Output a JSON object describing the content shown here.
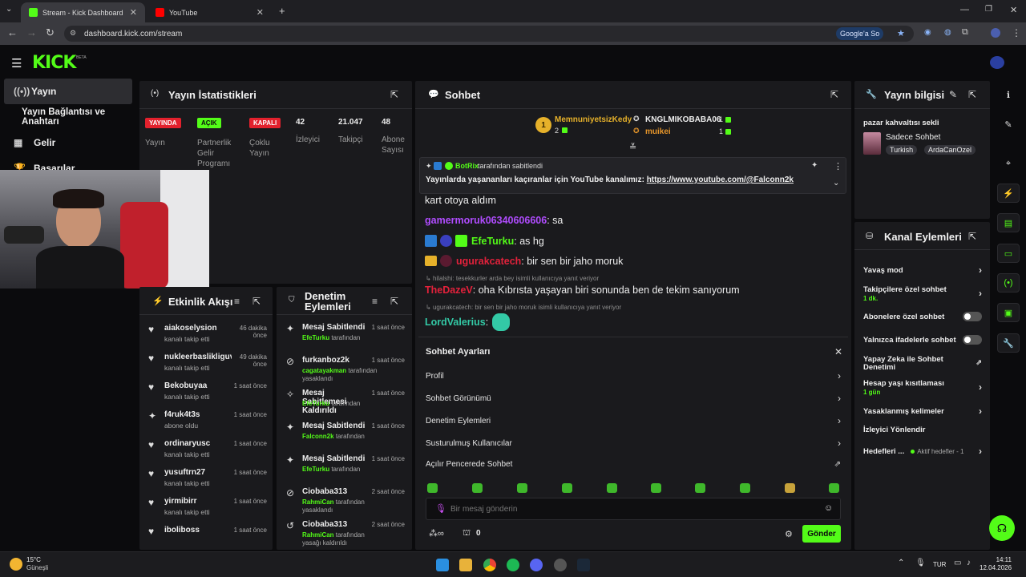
{
  "browser": {
    "tabs": [
      {
        "title": "Stream - Kick Dashboard"
      },
      {
        "title": "YouTube"
      }
    ],
    "url": "dashboard.kick.com/stream",
    "search_chip": "Google'a So"
  },
  "header": {
    "logo": "KICK",
    "beta": "BETA"
  },
  "sidebar": {
    "items": [
      {
        "label": "Yayın",
        "icon": "broadcast-icon"
      },
      {
        "label": "Yayın Bağlantısı ve Anahtarı",
        "icon": ""
      },
      {
        "label": "Gelir",
        "icon": "chart-icon"
      },
      {
        "label": "Başarılar",
        "icon": "trophy-icon"
      }
    ]
  },
  "stats": {
    "title": "Yayın İstatistikleri",
    "badges": [
      {
        "text": "YAYINDA",
        "label": "Yayın",
        "color": "#e3212d"
      },
      {
        "text": "AÇIK",
        "label": "Partnerlik Gelir Programı",
        "color": "#53fc18"
      },
      {
        "text": "KAPALI",
        "label": "Çoklu Yayın",
        "color": "#e3212d"
      }
    ],
    "numbers": [
      {
        "value": "42",
        "label": "İzleyici"
      },
      {
        "value": "21.047",
        "label": "Takipçi"
      },
      {
        "value": "48",
        "label": "Abone Sayısı"
      }
    ]
  },
  "activity": {
    "title": "Etkinlik Akışı",
    "items": [
      {
        "name": "aiakoselysion",
        "time": "46 dakika önce",
        "sub": "kanalı takip etti",
        "icon": "heart-icon"
      },
      {
        "name": "nukleerbaslikliguvercin",
        "time": "49 dakika önce",
        "sub": "kanalı takip etti",
        "icon": "heart-icon"
      },
      {
        "name": "Bekobuyaa",
        "time": "1 saat önce",
        "sub": "kanalı takip etti",
        "icon": "heart-icon"
      },
      {
        "name": "f4ruk4t3s",
        "time": "1 saat önce",
        "sub": "abone oldu",
        "icon": "star-icon"
      },
      {
        "name": "ordinaryusc",
        "time": "1 saat önce",
        "sub": "kanalı takip etti",
        "icon": "heart-icon"
      },
      {
        "name": "yusuftrn27",
        "time": "1 saat önce",
        "sub": "kanalı takip etti",
        "icon": "heart-icon"
      },
      {
        "name": "yirmibirr",
        "time": "1 saat önce",
        "sub": "kanalı takip etti",
        "icon": "heart-icon"
      },
      {
        "name": "iboliboss",
        "time": "1 saat önce",
        "sub": "",
        "icon": "heart-icon"
      }
    ]
  },
  "moderation": {
    "title": "Denetim Eylemleri",
    "items": [
      {
        "name": "Mesaj Sabitlendi",
        "time": "1 saat önce",
        "actor": "EfeTurku",
        "sub": "tarafından",
        "icon": "pin-icon"
      },
      {
        "name": "furkanboz2k",
        "time": "1 saat önce",
        "actor": "cagatayakman",
        "sub": "tarafından yasaklandı",
        "icon": "ban-icon"
      },
      {
        "name": "Mesaj Sabitlemesi Kaldırıldı",
        "time": "1 saat önce",
        "actor": "EfeTurku",
        "sub": "tarafından",
        "icon": "unpin-icon"
      },
      {
        "name": "Mesaj Sabitlendi",
        "time": "1 saat önce",
        "actor": "Falconn2k",
        "sub": "tarafından",
        "icon": "pin-icon"
      },
      {
        "name": "Mesaj Sabitlendi",
        "time": "1 saat önce",
        "actor": "EfeTurku",
        "sub": "tarafından",
        "icon": "pin-icon"
      },
      {
        "name": "Ciobaba313",
        "time": "2 saat önce",
        "actor": "RahmiCan",
        "sub": "tarafından yasaklandı",
        "icon": "ban-icon"
      },
      {
        "name": "Ciobaba313",
        "time": "2 saat önce",
        "actor": "RahmiCan",
        "sub": "tarafından yasağı kaldırıldı",
        "icon": "undo-icon"
      }
    ]
  },
  "chat": {
    "title": "Sohbet",
    "leaderboard": [
      {
        "name": "MemnuniyetsizKedy",
        "count": "2"
      },
      {
        "name": "KNGLMIKOBABA06",
        "count": "1"
      },
      {
        "name": "muikei",
        "count": "1"
      }
    ],
    "pinned": {
      "author": "BotRix",
      "by": "tarafından sabitlendi",
      "text": "Yayınlarda yaşananları kaçıranlar için YouTube kanalımız: ",
      "link": "https://www.youtube.com/@Falconn2k"
    },
    "messages": [
      {
        "user": "",
        "text": "kart otoya aldım",
        "color": "#eeeeee"
      },
      {
        "user": "gamermoruk06340606606",
        "text": ": sa",
        "color": "#b04cff"
      },
      {
        "user": "EfeTurku",
        "text": ": as hg",
        "color": "#53fc18"
      },
      {
        "user": "ugurakcatech",
        "text": ": bir sen bir jaho moruk",
        "color": "#e3213b"
      },
      {
        "user": "TheDazeV",
        "text": ": oha Kıbrısta yaşayan biri sonunda ben de tekim sanıyorum",
        "color": "#e3213b",
        "reply": "hilalshi: tesekkurler arda bey isimli kullanıcıya yanıt veriyor"
      },
      {
        "user": "LordValerius",
        "text": ":",
        "color": "#33c9a6",
        "reply": "ugurakcatech: bir sen bir jaho moruk isimli kullanıcıya yanıt veriyor"
      }
    ],
    "settings": {
      "title": "Sohbet Ayarları",
      "rows": [
        "Profil",
        "Sohbet Görünümü",
        "Denetim Eylemleri",
        "Susturulmuş Kullanıcılar",
        "Açılır Pencerede Sohbet"
      ]
    },
    "input_placeholder": "Bir mesaj gönderin",
    "points": "0",
    "send_label": "Gönder"
  },
  "stream_info": {
    "title": "Yayın bilgisi",
    "stream_title": "pazar kahvaltısı sekli",
    "category": "Sadece Sohbet",
    "tags": [
      "Turkish",
      "ArdaCanOzel"
    ]
  },
  "channel_actions": {
    "title": "Kanal Eylemleri",
    "rows": [
      {
        "label": "Yavaş mod",
        "type": "chevron",
        "sub": ""
      },
      {
        "label": "Takipçilere özel sohbet",
        "type": "chevron",
        "sub": "1 dk."
      },
      {
        "label": "Abonelere özel sohbet",
        "type": "toggle",
        "sub": ""
      },
      {
        "label": "Yalnızca ifadelerle sohbet",
        "type": "toggle",
        "sub": ""
      },
      {
        "label": "Yapay Zeka ile Sohbet Denetimi",
        "type": "external",
        "sub": ""
      },
      {
        "label": "Hesap yaşı kısıtlaması",
        "type": "chevron",
        "sub": "1 gün"
      },
      {
        "label": "Yasaklanmış kelimeler",
        "type": "chevron",
        "sub": ""
      },
      {
        "label": "İzleyici Yönlendir",
        "type": "none",
        "sub": ""
      },
      {
        "label": "Hedefleri ...",
        "type": "chevron",
        "sub": "",
        "extra": "Aktif hedefler - 1"
      }
    ]
  },
  "colors": {
    "accent": "#53fc18",
    "live": "#e3212d",
    "panel": "#1a1a1d"
  },
  "taskbar": {
    "weather_temp": "15°C",
    "weather_text": "Güneşli",
    "lang": "TUR",
    "time": "14:11",
    "date": "12.04.2026"
  }
}
